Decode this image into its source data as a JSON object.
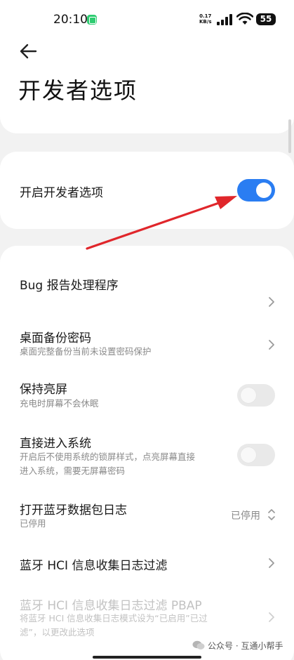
{
  "status_bar": {
    "time": "20:10",
    "net_speed_value": "0.17",
    "net_speed_unit": "KB/s",
    "battery": "55",
    "signal_icon": "cellular-signal-icon",
    "wifi_icon": "wifi-icon"
  },
  "header": {
    "title": "开发者选项",
    "back_icon": "arrow-left-icon"
  },
  "developer_toggle": {
    "label": "开启开发者选项",
    "on": true
  },
  "settings": {
    "bug_report": {
      "title": "Bug 报告处理程序"
    },
    "desktop_backup": {
      "title": "桌面备份密码",
      "subtitle": "桌面完整备份当前未设置密码保护"
    },
    "stay_awake": {
      "title": "保持亮屏",
      "subtitle": "充电时屏幕不会休眠",
      "on": false
    },
    "direct_enter": {
      "title": "直接进入系统",
      "subtitle_line1": "开启后不使用系统的锁屏样式，点亮屏幕直接",
      "subtitle_line2": "进入系统，需要无屏幕密码",
      "on": false
    },
    "bt_log": {
      "title": "打开蓝牙数据包日志",
      "subtitle": "已停用",
      "value": "已停用"
    },
    "bt_hci_filter": {
      "title": "蓝牙 HCI 信息收集日志过滤"
    },
    "bt_hci_pbap": {
      "title": "蓝牙 HCI 信息收集日志过滤 PBAP",
      "subtitle_line1": "将蓝牙 HCI 信息收集日志模式设为“已启用”已过",
      "subtitle_line2": "滤”，以更改此选项"
    }
  },
  "watermark": {
    "text": "公众号 · 互通小帮手"
  },
  "colors": {
    "accent": "#2a7df2",
    "annotation_arrow": "#e0262b",
    "background": "#f2f2f2"
  }
}
